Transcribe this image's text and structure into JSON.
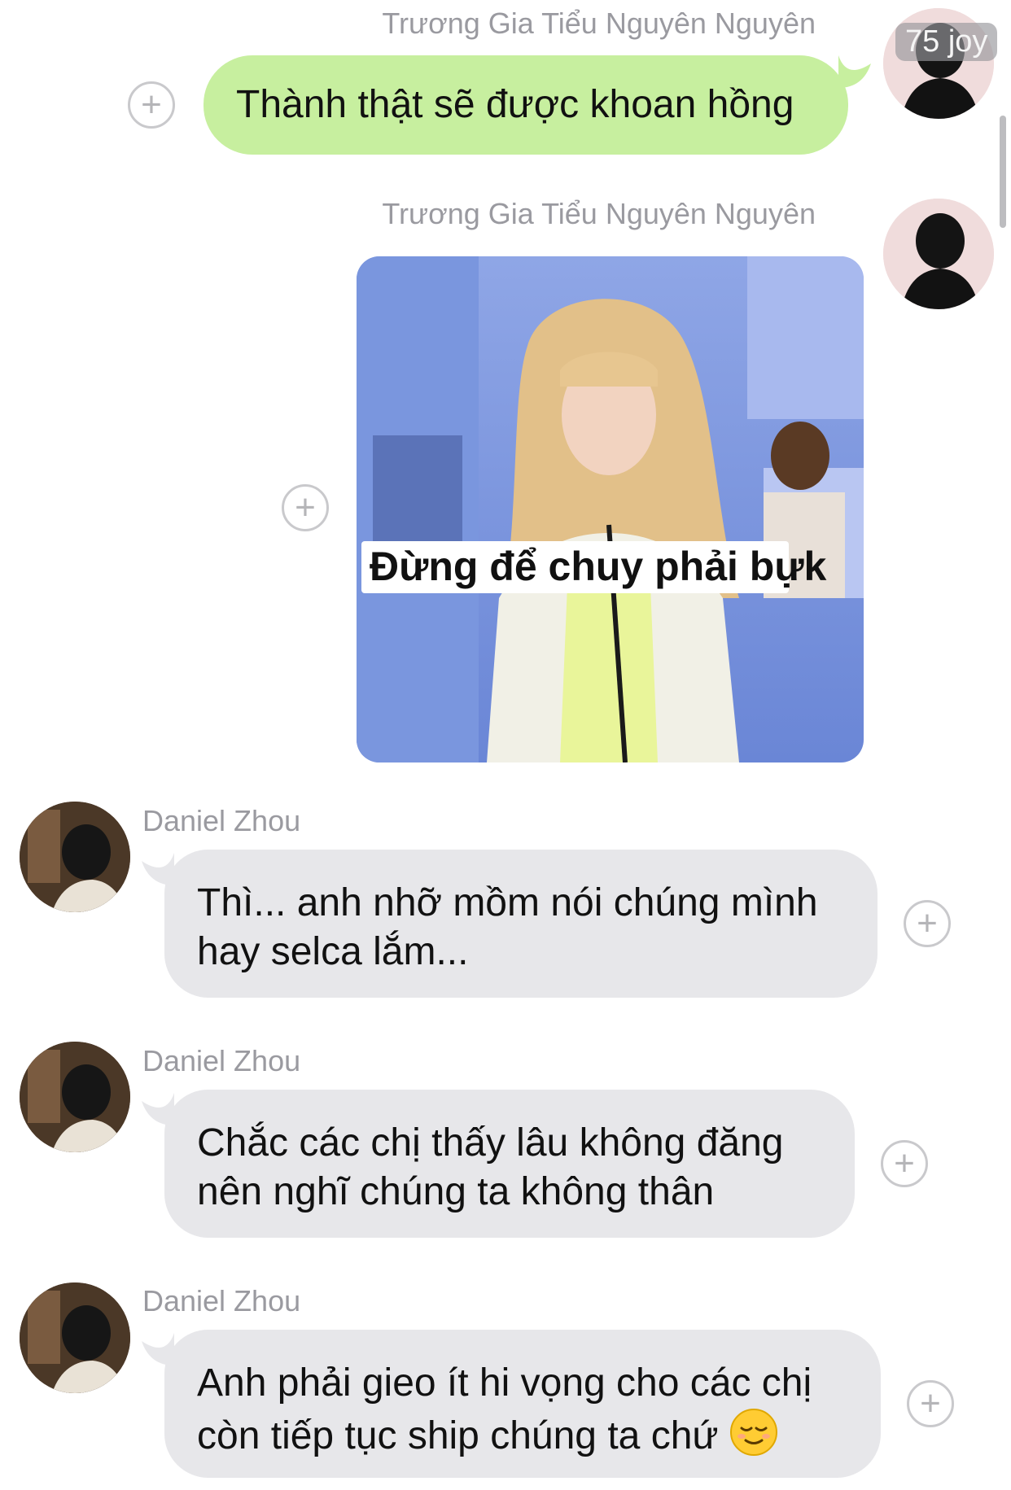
{
  "watermark": "75 joy",
  "messages": [
    {
      "sender": "Trương Gia Tiểu Nguyên Nguyên",
      "text": "Thành thật sẽ được khoan hồng"
    },
    {
      "sender": "Trương Gia Tiểu Nguyên Nguyên",
      "sticker_caption": "Đừng để chuy phải bựk"
    },
    {
      "sender": "Daniel Zhou",
      "lines": [
        "Thì... anh nhỡ mồm nói chúng mình",
        "hay selca lắm..."
      ]
    },
    {
      "sender": "Daniel Zhou",
      "lines": [
        "Chắc các chị thấy lâu không đăng",
        "nên nghĩ chúng ta không thân"
      ]
    },
    {
      "sender": "Daniel Zhou",
      "lines": [
        "Anh phải gieo ít hi vọng cho các chị",
        "còn tiếp tục ship chúng ta chứ"
      ],
      "emoji": "relieved-face"
    }
  ],
  "colors": {
    "outgoing_bubble": "#c7ef9f",
    "incoming_bubble": "#e7e7ea",
    "sender_name": "#9a9aa0"
  }
}
